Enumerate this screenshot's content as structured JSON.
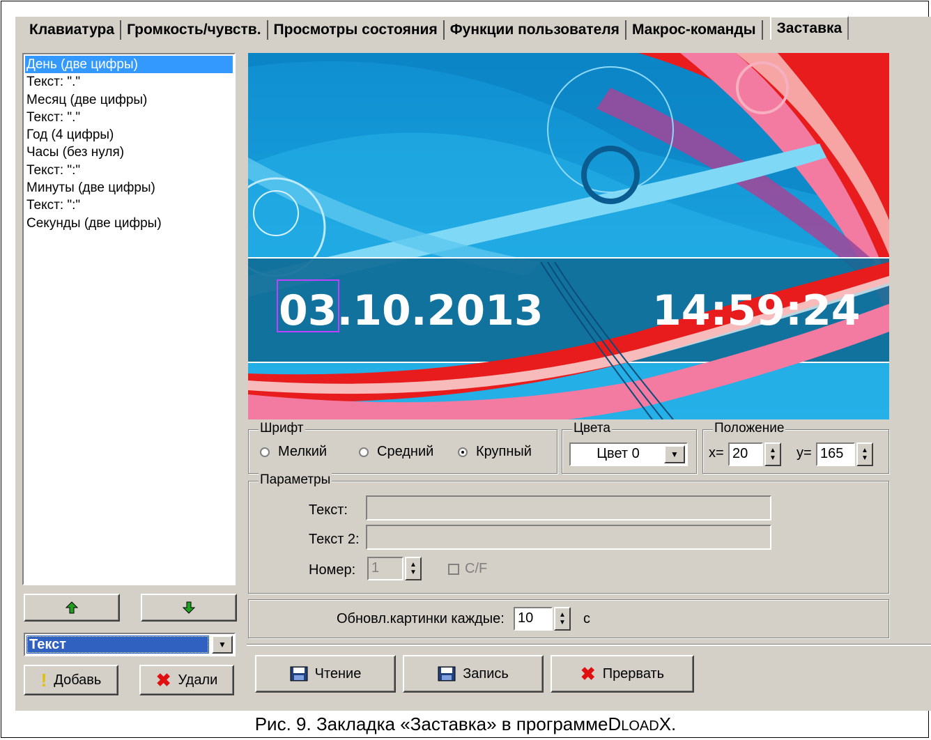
{
  "tabs": [
    "Клавиатура",
    "Громкость/чувств.",
    "Просмотры состояния",
    "Функции пользователя",
    "Макрос-команды",
    "Заставка"
  ],
  "list_items": [
    "День (две цифры)",
    "Текст: \".\"",
    "Месяц (две цифры)",
    "Текст: \".\"",
    "Год (4 цифры)",
    "Часы (без нуля)",
    "Текст: \":\"",
    "Минуты (две цифры)",
    "Текст: \":\"",
    "Секунды (две цифры)"
  ],
  "selected_index": 0,
  "element_type": "Текст",
  "buttons": {
    "add": "Добавь",
    "delete": "Удали",
    "read": "Чтение",
    "write": "Запись",
    "abort": "Прервать"
  },
  "preview": {
    "date": "03.10.2013",
    "time": "14:59:24"
  },
  "font_group": {
    "label": "Шрифт",
    "options": [
      "Мелкий",
      "Средний",
      "Крупный"
    ],
    "selected": "Крупный"
  },
  "color_group": {
    "label": "Цвета",
    "value": "Цвет 0"
  },
  "position_group": {
    "label": "Положение",
    "x_label": "x=",
    "x_value": "20",
    "y_label": "y=",
    "y_value": "165"
  },
  "params_group": {
    "label": "Параметры",
    "text_label": "Текст:",
    "text_value": "",
    "text2_label": "Текст 2:",
    "text2_value": "",
    "number_label": "Номер:",
    "number_value": "1",
    "cf_label": "C/F"
  },
  "refresh": {
    "label": "Обновл.картинки каждые:",
    "value": "10",
    "unit": "с"
  },
  "caption": {
    "prefix": "Рис. 9. Закладка «Заставка» в программе",
    "d": "D",
    "load": "LOAD",
    "x": "X."
  },
  "colors": {
    "selection": "#3399ff",
    "window": "#d4d0c8",
    "preview_blue": "#1aa0dc"
  }
}
